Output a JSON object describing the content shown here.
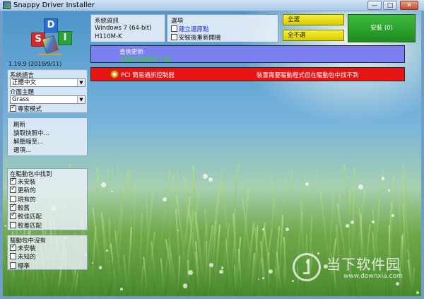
{
  "window": {
    "title": "Snappy Driver Installer",
    "minimize": "—",
    "maximize": "□",
    "close": "✕"
  },
  "logo": {
    "letters": [
      "S",
      "D",
      "I"
    ]
  },
  "version": "1.19.9 (2019/9/11)",
  "settings": {
    "language_label": "系統語言",
    "language_value": "正體中文",
    "theme_label": "介面主題",
    "theme_value": "Grass",
    "expert_mode": "專家模式"
  },
  "actions": [
    "刷新",
    "讀取快照中...",
    "解壓縮至...",
    "選項..."
  ],
  "found_group": {
    "title": "在驅動包中找到",
    "items": [
      {
        "label": "未安裝",
        "checked": true
      },
      {
        "label": "更新的",
        "checked": true
      },
      {
        "label": "現有的",
        "checked": false
      },
      {
        "label": "較舊",
        "checked": true
      },
      {
        "label": "較佳匹配",
        "checked": true
      },
      {
        "label": "較差匹配",
        "checked": false
      }
    ]
  },
  "notfound_group": {
    "title": "驅動包中沒有",
    "items": [
      {
        "label": "未安裝",
        "checked": true
      },
      {
        "label": "未知的",
        "checked": false
      },
      {
        "label": "標準",
        "checked": false
      }
    ]
  },
  "sysinfo": {
    "title": "系統資訊",
    "os": "Windows 7 (64-bit)",
    "board": "H110M-K"
  },
  "options": {
    "title": "選項",
    "restore_point": "建立還原點",
    "restart": "安裝後重新開機"
  },
  "buttons": {
    "select_all": "全選",
    "select_none": "全不選",
    "install": "安裝 (0)"
  },
  "list": {
    "update_check": "查詢更新",
    "update_status": "(點擊這裡開始下載)",
    "device_name": "PCI 簡易通訊控制器",
    "device_status": "裝置需要驅動程式但在驅動包中找不到"
  },
  "watermark": {
    "text": "当下软件园",
    "url": "www.downxia.com"
  },
  "colors": {
    "update_bar": "#7b7ff0",
    "missing_bar": "#e81414",
    "select_button": "#f0e616",
    "install_button": "#25962a"
  }
}
